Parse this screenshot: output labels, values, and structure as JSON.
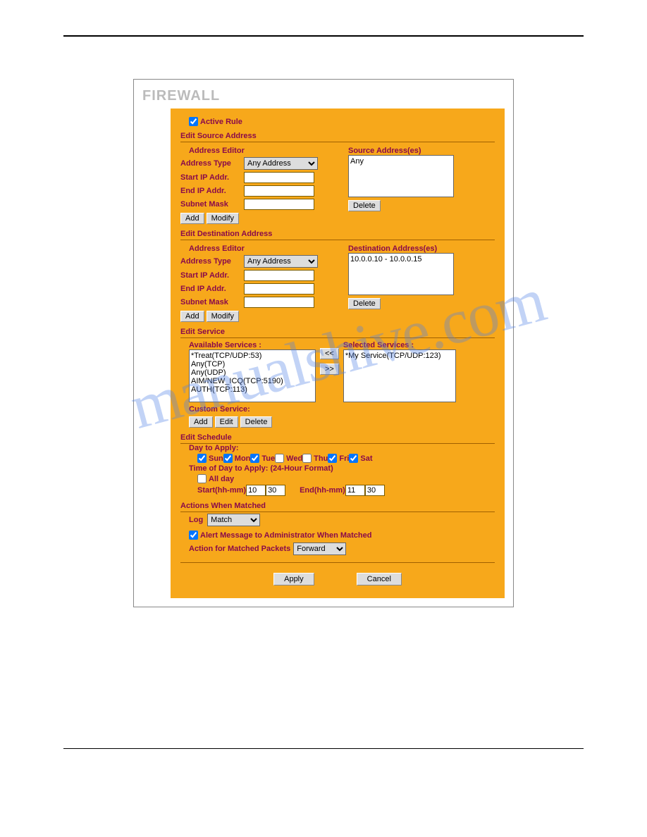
{
  "watermark": "manualshive.com",
  "title": "FIREWALL",
  "activeRule": {
    "label": "Active Rule",
    "checked": true
  },
  "editSource": {
    "heading": "Edit Source Address",
    "editor": {
      "title": "Address Editor",
      "addressTypeLabel": "Address Type",
      "addressTypeSelected": "Any Address",
      "startIpLabel": "Start IP Addr.",
      "startIpValue": "",
      "endIpLabel": "End IP Addr.",
      "endIpValue": "",
      "subnetLabel": "Subnet Mask",
      "subnetValue": "",
      "addBtn": "Add",
      "modifyBtn": "Modify"
    },
    "list": {
      "title": "Source Address(es)",
      "items": [
        "Any"
      ],
      "deleteBtn": "Delete"
    }
  },
  "editDest": {
    "heading": "Edit Destination Address",
    "editor": {
      "title": "Address Editor",
      "addressTypeLabel": "Address Type",
      "addressTypeSelected": "Any Address",
      "startIpLabel": "Start IP Addr.",
      "startIpValue": "",
      "endIpLabel": "End IP Addr.",
      "endIpValue": "",
      "subnetLabel": "Subnet Mask",
      "subnetValue": "",
      "addBtn": "Add",
      "modifyBtn": "Modify"
    },
    "list": {
      "title": "Destination Address(es)",
      "items": [
        "10.0.0.10 - 10.0.0.15"
      ],
      "deleteBtn": "Delete"
    }
  },
  "editService": {
    "heading": "Edit Service",
    "availableLabel": "Available Services :",
    "available": [
      "*Treat(TCP/UDP:53)",
      "Any(TCP)",
      "Any(UDP)",
      "AIM/NEW_ICQ(TCP:5190)",
      "AUTH(TCP:113)"
    ],
    "moveLeft": "<<",
    "moveRight": ">>",
    "selectedLabel": "Selected Services :",
    "selected": [
      "*My Service(TCP/UDP:123)"
    ],
    "customLabel": "Custom Service:",
    "addBtn": "Add",
    "editBtn": "Edit",
    "deleteBtn": "Delete"
  },
  "editSchedule": {
    "heading": "Edit Schedule",
    "dayLabel": "Day to Apply:",
    "days": [
      {
        "label": "Sun",
        "checked": true
      },
      {
        "label": "Mon",
        "checked": true
      },
      {
        "label": "Tue",
        "checked": true
      },
      {
        "label": "Wed",
        "checked": false
      },
      {
        "label": "Thu",
        "checked": false
      },
      {
        "label": "Fri",
        "checked": true
      },
      {
        "label": "Sat",
        "checked": true
      }
    ],
    "timeLabel": "Time of Day to Apply: (24-Hour Format)",
    "allDayLabel": "All day",
    "allDayChecked": false,
    "startLabel": "Start(hh-mm)",
    "startHH": "10",
    "startMM": "30",
    "endLabel": "End(hh-mm)",
    "endHH": "11",
    "endMM": "30"
  },
  "actions": {
    "heading": "Actions When Matched",
    "logLabel": "Log",
    "logSelected": "Match",
    "alertLabel": "Alert Message to Administrator When Matched",
    "alertChecked": true,
    "actionLabel": "Action for Matched Packets",
    "actionSelected": "Forward"
  },
  "applyBtn": "Apply",
  "cancelBtn": "Cancel"
}
